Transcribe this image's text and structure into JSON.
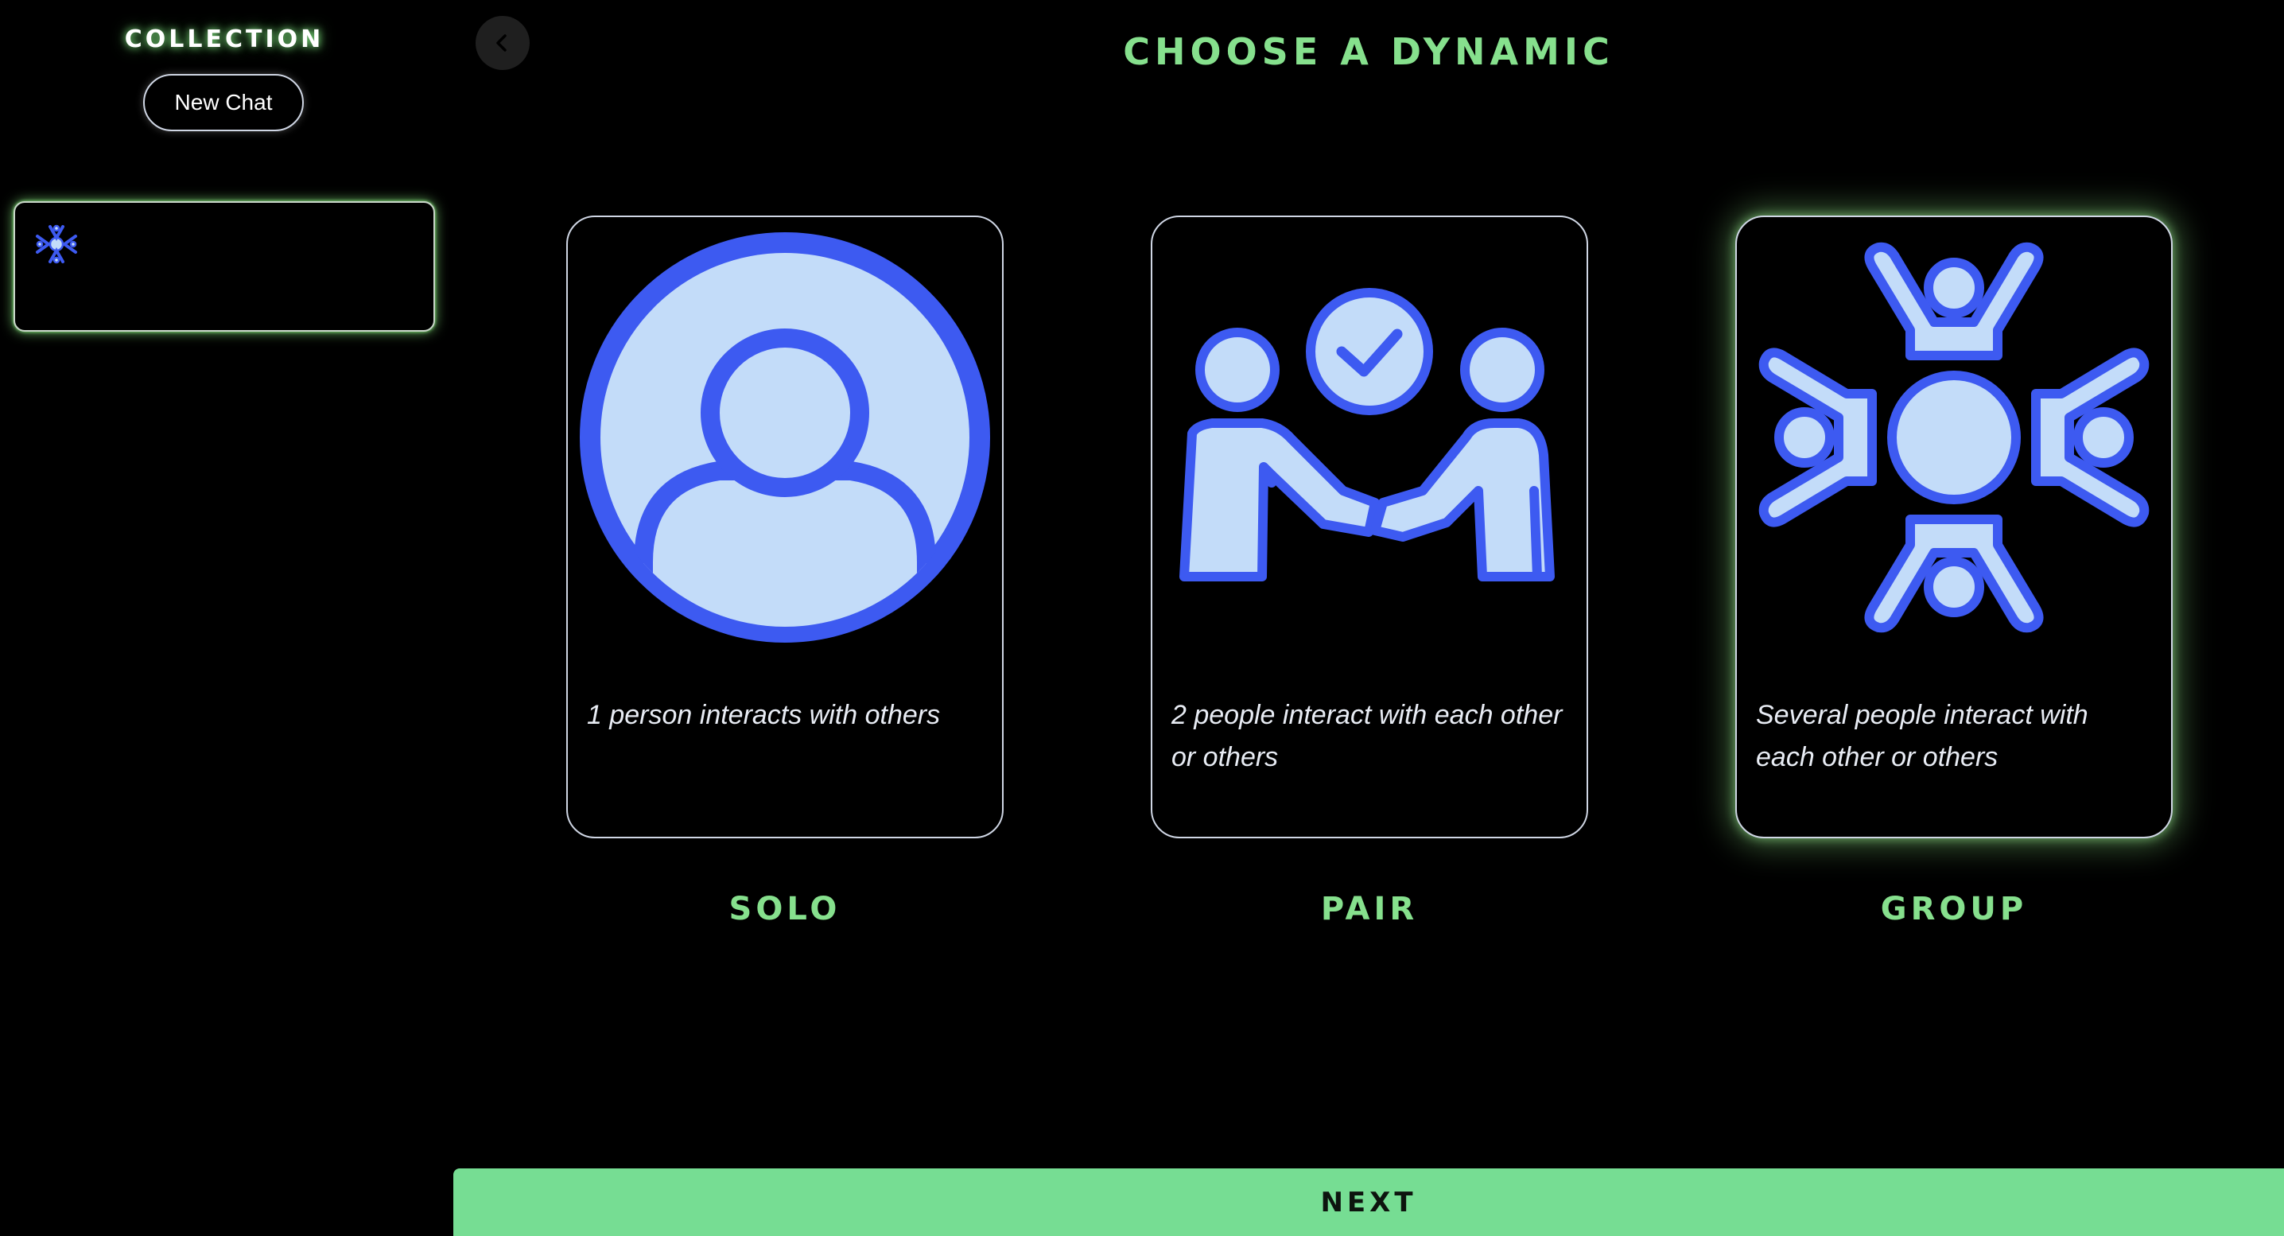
{
  "sidebar": {
    "title": "COLLECTION",
    "new_chat_label": "New Chat",
    "chat_items": [
      {
        "icon": "group-icon",
        "label": ""
      }
    ]
  },
  "header": {
    "back_icon": "chevron-left-icon",
    "title": "CHOOSE A DYNAMIC"
  },
  "options": [
    {
      "id": "solo",
      "label": "SOLO",
      "description": "1 person interacts with others",
      "icon": "person-icon",
      "selected": false
    },
    {
      "id": "pair",
      "label": "PAIR",
      "description": "2 people interact with each other or others",
      "icon": "handshake-icon",
      "selected": false
    },
    {
      "id": "group",
      "label": "GROUP",
      "description": "Several people interact with each other or others",
      "icon": "group-icon",
      "selected": true
    }
  ],
  "footer": {
    "next_label": "NEXT"
  },
  "colors": {
    "accent_green": "#86e08d",
    "button_green": "#76dd93",
    "icon_blue": "#3d5af1",
    "icon_fill": "#c3dcf9"
  }
}
